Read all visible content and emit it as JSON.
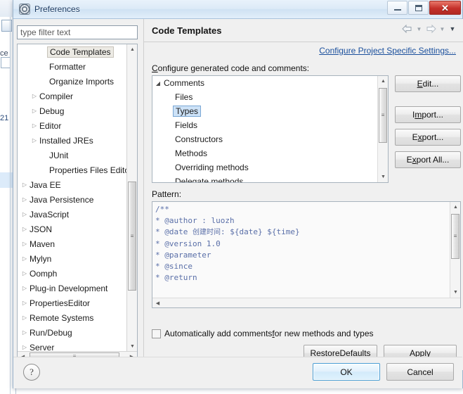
{
  "window": {
    "title": "Preferences",
    "icon": "preferences-gear-icon",
    "minimize_label": "",
    "maximize_label": "",
    "close_label": "✕"
  },
  "background": {
    "left_label_1": "ce",
    "left_label_2": "21"
  },
  "filter": {
    "placeholder": "type filter text",
    "value": ""
  },
  "tree": {
    "items": [
      {
        "label": "Code Templates",
        "level": 2,
        "arrow": "",
        "selected": true
      },
      {
        "label": "Formatter",
        "level": 2,
        "arrow": "",
        "selected": false
      },
      {
        "label": "Organize Imports",
        "level": 2,
        "arrow": "",
        "selected": false
      },
      {
        "label": "Compiler",
        "level": 1,
        "arrow": "▷",
        "selected": false
      },
      {
        "label": "Debug",
        "level": 1,
        "arrow": "▷",
        "selected": false
      },
      {
        "label": "Editor",
        "level": 1,
        "arrow": "▷",
        "selected": false
      },
      {
        "label": "Installed JREs",
        "level": 1,
        "arrow": "▷",
        "selected": false
      },
      {
        "label": "JUnit",
        "level": 2,
        "arrow": "",
        "selected": false
      },
      {
        "label": "Properties Files Editor",
        "level": 2,
        "arrow": "",
        "selected": false
      },
      {
        "label": "Java EE",
        "level": 0,
        "arrow": "▷",
        "selected": false
      },
      {
        "label": "Java Persistence",
        "level": 0,
        "arrow": "▷",
        "selected": false
      },
      {
        "label": "JavaScript",
        "level": 0,
        "arrow": "▷",
        "selected": false
      },
      {
        "label": "JSON",
        "level": 0,
        "arrow": "▷",
        "selected": false
      },
      {
        "label": "Maven",
        "level": 0,
        "arrow": "▷",
        "selected": false
      },
      {
        "label": "Mylyn",
        "level": 0,
        "arrow": "▷",
        "selected": false
      },
      {
        "label": "Oomph",
        "level": 0,
        "arrow": "▷",
        "selected": false
      },
      {
        "label": "Plug-in Development",
        "level": 0,
        "arrow": "▷",
        "selected": false
      },
      {
        "label": "PropertiesEditor",
        "level": 0,
        "arrow": "▷",
        "selected": false
      },
      {
        "label": "Remote Systems",
        "level": 0,
        "arrow": "▷",
        "selected": false
      },
      {
        "label": "Run/Debug",
        "level": 0,
        "arrow": "▷",
        "selected": false
      },
      {
        "label": "Server",
        "level": 0,
        "arrow": "▷",
        "selected": false
      }
    ],
    "scroll_up_glyph": "▲",
    "scroll_down_glyph": "▼",
    "scroll_left_glyph": "◀",
    "scroll_right_glyph": "▶",
    "grip_glyph": "≡"
  },
  "page": {
    "title": "Code Templates",
    "configure_link": "Configure Project Specific Settings...",
    "configure_label_prefix": "C",
    "configure_label_rest": "onfigure generated code and comments:",
    "nav": {
      "back_icon": "arrow-left-icon",
      "back_caret": "▼",
      "forward_icon": "arrow-right-icon",
      "forward_caret": "▼",
      "view_menu": "▼"
    }
  },
  "comments_tree": {
    "root": {
      "label": "Comments",
      "triangle": "◢"
    },
    "children": [
      {
        "label": "Files",
        "selected": false
      },
      {
        "label": "Types",
        "selected": true
      },
      {
        "label": "Fields",
        "selected": false
      },
      {
        "label": "Constructors",
        "selected": false
      },
      {
        "label": "Methods",
        "selected": false
      },
      {
        "label": "Overriding methods",
        "selected": false
      },
      {
        "label": "Delegate methods",
        "selected": false
      }
    ],
    "scroll_up_glyph": "▲",
    "scroll_down_glyph": "▼",
    "grip_glyph": "≡"
  },
  "side_buttons": {
    "edit": {
      "mnemonic": "E",
      "rest": "dit...",
      "full": "Edit..."
    },
    "import": {
      "prefix": "I",
      "mnemonic": "m",
      "rest": "port...",
      "full": "Import..."
    },
    "export": {
      "prefix": "E",
      "mnemonic": "x",
      "rest": "port...",
      "full": "Export..."
    },
    "export_all": {
      "prefix": "E",
      "mnemonic": "x",
      "rest": "port All...",
      "full": "Export All..."
    }
  },
  "pattern": {
    "label_prefix": "Pa",
    "label_mnemonic": "tt",
    "label_rest": "ern:",
    "label_full": "Pattern:",
    "lines": [
      "/**",
      "* @author : luozh",
      "* @date 创建时间: ${date} ${time}",
      "* @version 1.0",
      "* @parameter",
      "* @since",
      "* @return"
    ],
    "scroll_up_glyph": "▲",
    "scroll_down_glyph": "▼",
    "scroll_left_glyph": "◀",
    "grip_glyph": "≡"
  },
  "auto_comments": {
    "checked": false,
    "prefix": "Automatically add comments ",
    "mnemonic": "f",
    "rest": "or new methods and types",
    "full": "Automatically add comments for new methods and types"
  },
  "actions": {
    "restore_defaults": {
      "prefix": "Restore ",
      "mnemonic": "D",
      "rest": "efaults",
      "full": "Restore Defaults"
    },
    "apply": {
      "prefix": "",
      "mnemonic": "A",
      "rest": "pply",
      "full": "Apply"
    }
  },
  "footer": {
    "help_glyph": "?",
    "ok": "OK",
    "cancel": "Cancel"
  }
}
